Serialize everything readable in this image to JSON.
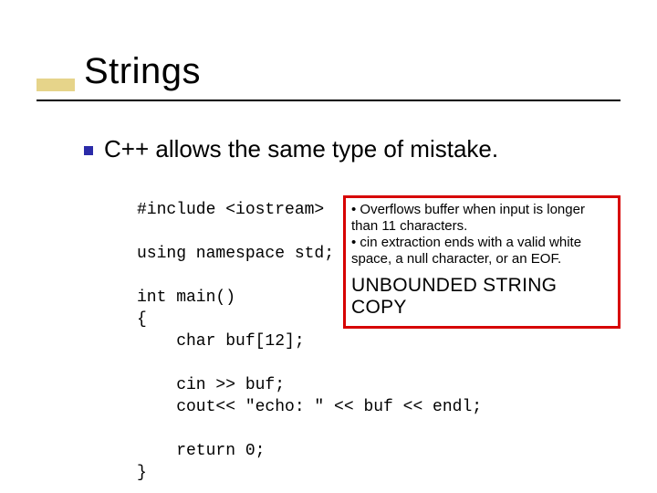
{
  "title": "Strings",
  "bullet": "C++ allows the same type of mistake.",
  "code": "#include <iostream>\n\nusing namespace std;\n\nint main()\n{\n    char buf[12];\n\n    cin >> buf;\n    cout<< \"echo: \" << buf << endl;\n\n    return 0;\n}",
  "callout": {
    "note1": "• Overflows buffer when input is longer than 11 characters.",
    "note2": "• cin extraction ends with a valid white space, a null character, or an EOF.",
    "headline": "UNBOUNDED STRING COPY"
  }
}
